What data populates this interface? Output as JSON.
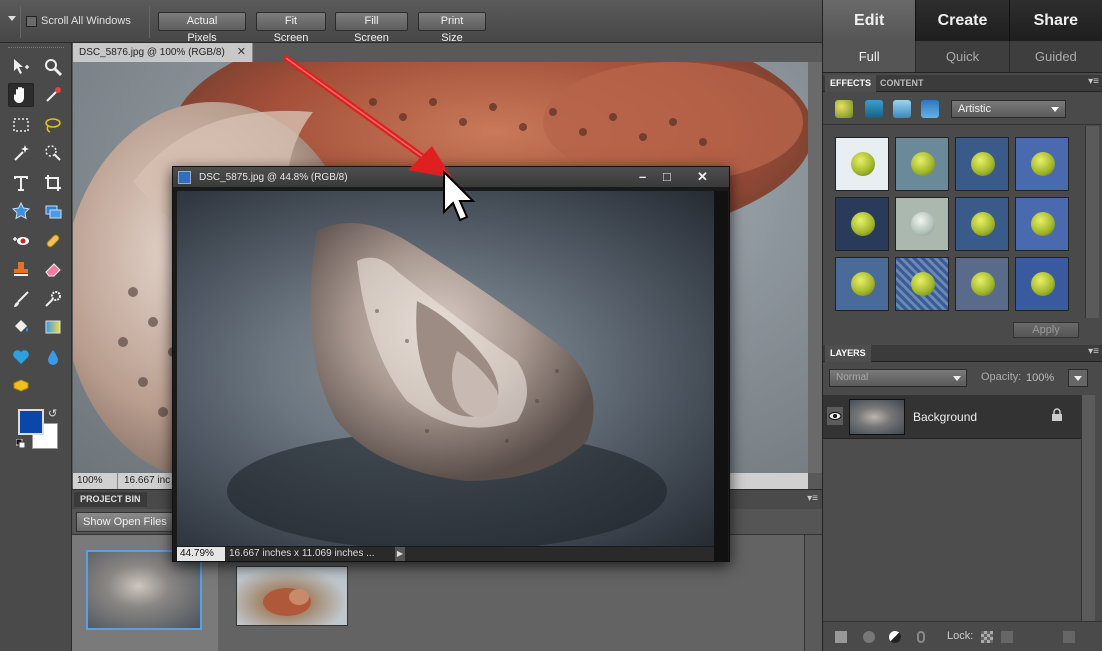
{
  "options_bar": {
    "scroll_all_windows": "Scroll All Windows",
    "buttons": [
      "Actual Pixels",
      "Fit Screen",
      "Fill Screen",
      "Print Size"
    ]
  },
  "document": {
    "tab_title": "DSC_5876.jpg @ 100% (RGB/8)",
    "zoom": "100%",
    "status_info": "16.667 inc"
  },
  "floating_window": {
    "title": "DSC_5875.jpg @ 44.8% (RGB/8)",
    "zoom": "44.79%",
    "status_info": "16.667 inches x 11.069 inches ..."
  },
  "project_bin": {
    "tab": "PROJECT BIN",
    "show_open_files": "Show Open Files"
  },
  "mode_tabs": [
    "Edit",
    "Create",
    "Share"
  ],
  "sub_tabs": [
    "Full",
    "Quick",
    "Guided"
  ],
  "effects_panel": {
    "tabs": [
      "EFFECTS",
      "CONTENT"
    ],
    "category": "Artistic",
    "apply": "Apply"
  },
  "layers_panel": {
    "tab": "LAYERS",
    "blend_mode": "Normal",
    "opacity_label": "Opacity:",
    "opacity_value": "100%",
    "layer_name": "Background",
    "lock_label": "Lock:"
  },
  "colors": {
    "foreground": "#0b47a8",
    "background": "#ffffff",
    "arrow": "#e02020"
  }
}
